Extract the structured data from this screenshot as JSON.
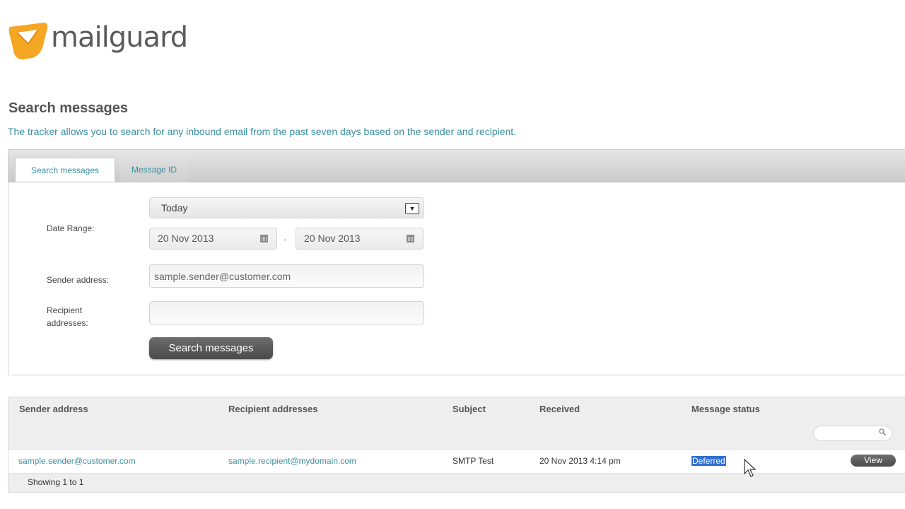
{
  "brand": {
    "name": "mailguard",
    "color": "#f5a623"
  },
  "page": {
    "title": "Search messages",
    "description": "The tracker allows you to search for any inbound email from the past seven days based on the sender and recipient."
  },
  "tabs": [
    {
      "label": "Search messages",
      "active": true
    },
    {
      "label": "Message ID",
      "active": false
    }
  ],
  "form": {
    "date_range_label": "Date Range:",
    "date_preset": "Today",
    "date_from": "20 Nov 2013",
    "date_separator": "-",
    "date_to": "20 Nov 2013",
    "sender_label": "Sender address:",
    "sender_value": "sample.sender@customer.com",
    "recipient_label_line1": "Recipient",
    "recipient_label_line2": "addresses:",
    "recipient_value": "",
    "search_button": "Search messages"
  },
  "results": {
    "columns": [
      "Sender address",
      "Recipient addresses",
      "Subject",
      "Received",
      "Message status"
    ],
    "rows": [
      {
        "sender": "sample.sender@customer.com",
        "recipient": "sample.recipient@mydomain.com",
        "subject": "SMTP Test",
        "received": "20 Nov 2013 4:14 pm",
        "status": "Deferred",
        "action": "View"
      }
    ],
    "footer": "Showing 1 to 1"
  }
}
